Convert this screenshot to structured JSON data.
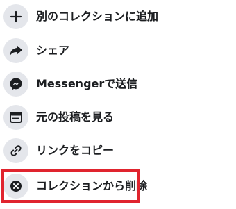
{
  "menu": {
    "items": [
      {
        "icon": "plus-icon",
        "label": "別のコレクションに追加"
      },
      {
        "icon": "share-arrow-icon",
        "label": "シェア"
      },
      {
        "icon": "messenger-icon",
        "label": "Messengerで送信"
      },
      {
        "icon": "post-window-icon",
        "label": "元の投稿を見る"
      },
      {
        "icon": "link-icon",
        "label": "リンクをコピー"
      },
      {
        "icon": "remove-x-icon",
        "label": "コレクションから削除"
      }
    ],
    "highlight_color": "#e0242e",
    "icon_bg_color": "#e4e6eb"
  }
}
